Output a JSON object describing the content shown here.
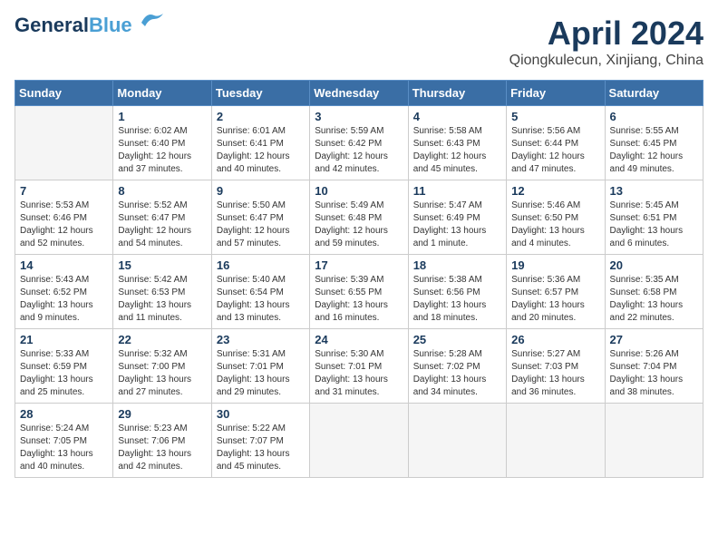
{
  "logo": {
    "line1": "General",
    "line2": "Blue"
  },
  "title": "April 2024",
  "subtitle": "Qiongkulecun, Xinjiang, China",
  "weekdays": [
    "Sunday",
    "Monday",
    "Tuesday",
    "Wednesday",
    "Thursday",
    "Friday",
    "Saturday"
  ],
  "weeks": [
    [
      {
        "day": "",
        "info": ""
      },
      {
        "day": "1",
        "info": "Sunrise: 6:02 AM\nSunset: 6:40 PM\nDaylight: 12 hours\nand 37 minutes."
      },
      {
        "day": "2",
        "info": "Sunrise: 6:01 AM\nSunset: 6:41 PM\nDaylight: 12 hours\nand 40 minutes."
      },
      {
        "day": "3",
        "info": "Sunrise: 5:59 AM\nSunset: 6:42 PM\nDaylight: 12 hours\nand 42 minutes."
      },
      {
        "day": "4",
        "info": "Sunrise: 5:58 AM\nSunset: 6:43 PM\nDaylight: 12 hours\nand 45 minutes."
      },
      {
        "day": "5",
        "info": "Sunrise: 5:56 AM\nSunset: 6:44 PM\nDaylight: 12 hours\nand 47 minutes."
      },
      {
        "day": "6",
        "info": "Sunrise: 5:55 AM\nSunset: 6:45 PM\nDaylight: 12 hours\nand 49 minutes."
      }
    ],
    [
      {
        "day": "7",
        "info": "Sunrise: 5:53 AM\nSunset: 6:46 PM\nDaylight: 12 hours\nand 52 minutes."
      },
      {
        "day": "8",
        "info": "Sunrise: 5:52 AM\nSunset: 6:47 PM\nDaylight: 12 hours\nand 54 minutes."
      },
      {
        "day": "9",
        "info": "Sunrise: 5:50 AM\nSunset: 6:47 PM\nDaylight: 12 hours\nand 57 minutes."
      },
      {
        "day": "10",
        "info": "Sunrise: 5:49 AM\nSunset: 6:48 PM\nDaylight: 12 hours\nand 59 minutes."
      },
      {
        "day": "11",
        "info": "Sunrise: 5:47 AM\nSunset: 6:49 PM\nDaylight: 13 hours\nand 1 minute."
      },
      {
        "day": "12",
        "info": "Sunrise: 5:46 AM\nSunset: 6:50 PM\nDaylight: 13 hours\nand 4 minutes."
      },
      {
        "day": "13",
        "info": "Sunrise: 5:45 AM\nSunset: 6:51 PM\nDaylight: 13 hours\nand 6 minutes."
      }
    ],
    [
      {
        "day": "14",
        "info": "Sunrise: 5:43 AM\nSunset: 6:52 PM\nDaylight: 13 hours\nand 9 minutes."
      },
      {
        "day": "15",
        "info": "Sunrise: 5:42 AM\nSunset: 6:53 PM\nDaylight: 13 hours\nand 11 minutes."
      },
      {
        "day": "16",
        "info": "Sunrise: 5:40 AM\nSunset: 6:54 PM\nDaylight: 13 hours\nand 13 minutes."
      },
      {
        "day": "17",
        "info": "Sunrise: 5:39 AM\nSunset: 6:55 PM\nDaylight: 13 hours\nand 16 minutes."
      },
      {
        "day": "18",
        "info": "Sunrise: 5:38 AM\nSunset: 6:56 PM\nDaylight: 13 hours\nand 18 minutes."
      },
      {
        "day": "19",
        "info": "Sunrise: 5:36 AM\nSunset: 6:57 PM\nDaylight: 13 hours\nand 20 minutes."
      },
      {
        "day": "20",
        "info": "Sunrise: 5:35 AM\nSunset: 6:58 PM\nDaylight: 13 hours\nand 22 minutes."
      }
    ],
    [
      {
        "day": "21",
        "info": "Sunrise: 5:33 AM\nSunset: 6:59 PM\nDaylight: 13 hours\nand 25 minutes."
      },
      {
        "day": "22",
        "info": "Sunrise: 5:32 AM\nSunset: 7:00 PM\nDaylight: 13 hours\nand 27 minutes."
      },
      {
        "day": "23",
        "info": "Sunrise: 5:31 AM\nSunset: 7:01 PM\nDaylight: 13 hours\nand 29 minutes."
      },
      {
        "day": "24",
        "info": "Sunrise: 5:30 AM\nSunset: 7:01 PM\nDaylight: 13 hours\nand 31 minutes."
      },
      {
        "day": "25",
        "info": "Sunrise: 5:28 AM\nSunset: 7:02 PM\nDaylight: 13 hours\nand 34 minutes."
      },
      {
        "day": "26",
        "info": "Sunrise: 5:27 AM\nSunset: 7:03 PM\nDaylight: 13 hours\nand 36 minutes."
      },
      {
        "day": "27",
        "info": "Sunrise: 5:26 AM\nSunset: 7:04 PM\nDaylight: 13 hours\nand 38 minutes."
      }
    ],
    [
      {
        "day": "28",
        "info": "Sunrise: 5:24 AM\nSunset: 7:05 PM\nDaylight: 13 hours\nand 40 minutes."
      },
      {
        "day": "29",
        "info": "Sunrise: 5:23 AM\nSunset: 7:06 PM\nDaylight: 13 hours\nand 42 minutes."
      },
      {
        "day": "30",
        "info": "Sunrise: 5:22 AM\nSunset: 7:07 PM\nDaylight: 13 hours\nand 45 minutes."
      },
      {
        "day": "",
        "info": ""
      },
      {
        "day": "",
        "info": ""
      },
      {
        "day": "",
        "info": ""
      },
      {
        "day": "",
        "info": ""
      }
    ]
  ]
}
